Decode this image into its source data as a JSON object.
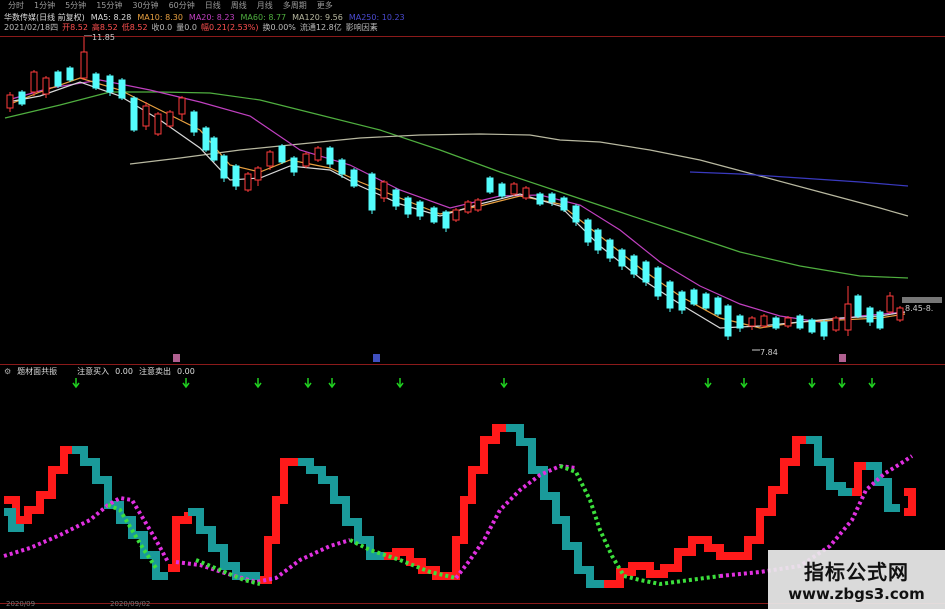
{
  "period_tabs": [
    "分时",
    "1分钟",
    "5分钟",
    "15分钟",
    "30分钟",
    "60分钟",
    "日线",
    "周线",
    "月线",
    "多周期",
    "更多"
  ],
  "ma_header": {
    "stock": "华数传媒(日线 前复权)",
    "ma5": "MA5: 8.28",
    "ma10": "MA10: 8.30",
    "ma20": "MA20: 8.23",
    "ma60": "MA60: 8.77",
    "ma120": "MA120: 9.56",
    "ma250": "MA250: 10.23"
  },
  "info_bar": [
    "2021/02/18四",
    "开8.52",
    "高8.52",
    "低8.52",
    "收0.0",
    "量0.0",
    "幅0.21(2.53%)",
    "换0.00%",
    "流通12.8亿",
    "影响因素"
  ],
  "annotations": {
    "high": "11.85",
    "low": "7.84",
    "right_price": "8.45-8."
  },
  "indicator": {
    "name": "题材面共振",
    "buy_label": "注意买入",
    "buy_value": "0.00",
    "sell_label": "注意卖出",
    "sell_value": "0.00"
  },
  "date_labels": [
    "2020/09",
    "2020/09/02"
  ],
  "watermark": {
    "title": "指标公式网",
    "url": "www.zbgs3.com"
  },
  "colors": {
    "up": "#ff3c3c",
    "down": "#54fcfc",
    "ma_orange": "#e8a040",
    "ma_purple": "#c040c0",
    "ma_green": "#4fae3f",
    "ma_gray": "#b8b8a0",
    "ma_blue": "#3a3ac0",
    "ind_red": "#ff1a1a",
    "ind_teal": "#1a9a9a",
    "ind_green": "#3ce03c",
    "ind_magenta": "#e030e0",
    "arrow_green": "#20d020"
  }
}
